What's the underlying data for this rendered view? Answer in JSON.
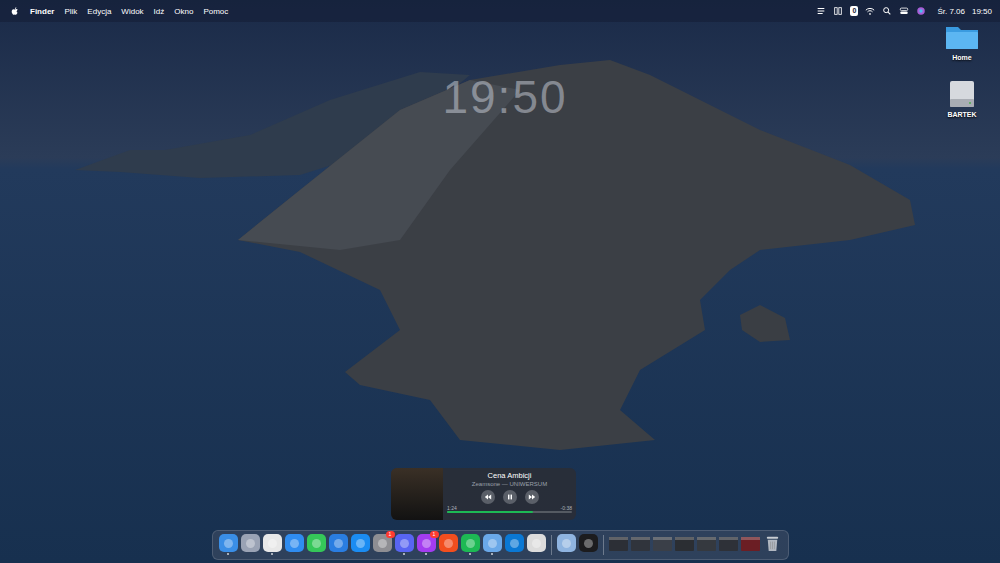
{
  "menu_bar": {
    "app": "Finder",
    "menus": [
      "Plik",
      "Edycja",
      "Widok",
      "Idź",
      "Okno",
      "Pomoc"
    ],
    "status_badge": "0",
    "date": "Śr. 7.06",
    "time": "19:50"
  },
  "clock_widget": {
    "time": "19:50"
  },
  "desktop_icons": [
    {
      "label": "Home",
      "kind": "folder",
      "selected": false
    },
    {
      "label": "BARTEK",
      "kind": "disk",
      "selected": false
    }
  ],
  "now_playing": {
    "title": "Cena Ambicji",
    "artist": "Zeamsone — UNIWERSUM",
    "elapsed": "1:24",
    "remaining": "-0:38",
    "level": 0.69,
    "playing": true
  },
  "dock": {
    "items": [
      {
        "kind": "app",
        "color": "#3a8ee6",
        "running": true
      },
      {
        "kind": "app",
        "color": "#9aa3b5",
        "running": false
      },
      {
        "kind": "app",
        "color": "#e8e8e8",
        "running": true
      },
      {
        "kind": "app",
        "color": "#2f8cf0",
        "running": false
      },
      {
        "kind": "app",
        "color": "#35c759",
        "running": false
      },
      {
        "kind": "app",
        "color": "#2a7de1",
        "running": false
      },
      {
        "kind": "app",
        "color": "#1b8cf2",
        "running": false
      },
      {
        "kind": "app",
        "color": "#8e8e93",
        "running": false,
        "badge": "1"
      },
      {
        "kind": "app",
        "color": "#5865f2",
        "running": true
      },
      {
        "kind": "app",
        "color": "#a33cf0",
        "running": true,
        "badge": "1"
      },
      {
        "kind": "app",
        "color": "#f24e1e",
        "running": false
      },
      {
        "kind": "app",
        "color": "#1db954",
        "running": true
      },
      {
        "kind": "app",
        "color": "#6aa8e8",
        "running": true
      },
      {
        "kind": "app",
        "color": "#0a78d4",
        "running": false
      },
      {
        "kind": "app",
        "color": "#dcdcdc",
        "running": false
      },
      {
        "kind": "separator"
      },
      {
        "kind": "app",
        "color": "#8fb4e0",
        "running": false
      },
      {
        "kind": "app",
        "color": "#1c1c1e",
        "running": false
      },
      {
        "kind": "separator"
      },
      {
        "kind": "window",
        "color": "#2c2f36"
      },
      {
        "kind": "window",
        "color": "#30343c"
      },
      {
        "kind": "window",
        "color": "#3a3f48"
      },
      {
        "kind": "window",
        "color": "#2b2e33"
      },
      {
        "kind": "window",
        "color": "#35393f"
      },
      {
        "kind": "window",
        "color": "#2e3138"
      },
      {
        "kind": "window",
        "color": "#6b1e24"
      },
      {
        "kind": "trash",
        "color": "#c8ccd2"
      }
    ]
  }
}
